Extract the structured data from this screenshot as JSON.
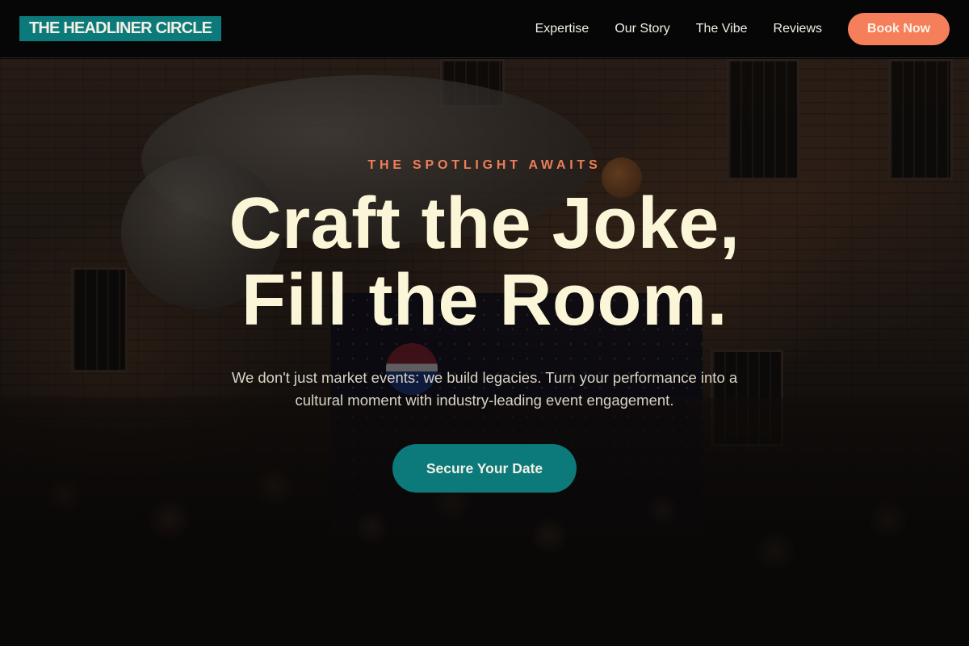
{
  "brand": {
    "name": "THE HEADLINER CIRCLE"
  },
  "nav": {
    "links": [
      {
        "label": "Expertise"
      },
      {
        "label": "Our Story"
      },
      {
        "label": "The Vibe"
      },
      {
        "label": "Reviews"
      }
    ],
    "cta_label": "Book Now"
  },
  "hero": {
    "eyebrow": "THE SPOTLIGHT AWAITS",
    "headline_line1": "Craft the Joke,",
    "headline_line2": "Fill the Room.",
    "subtitle": "We don't just market events: we build legacies. Turn your performance into a cultural moment with industry-leading event engagement.",
    "cta_label": "Secure Your Date"
  },
  "colors": {
    "accent_teal": "#0c7a7a",
    "accent_coral": "#f57f5b",
    "headline_cream": "#fcf6d8",
    "nav_background": "#060606"
  }
}
